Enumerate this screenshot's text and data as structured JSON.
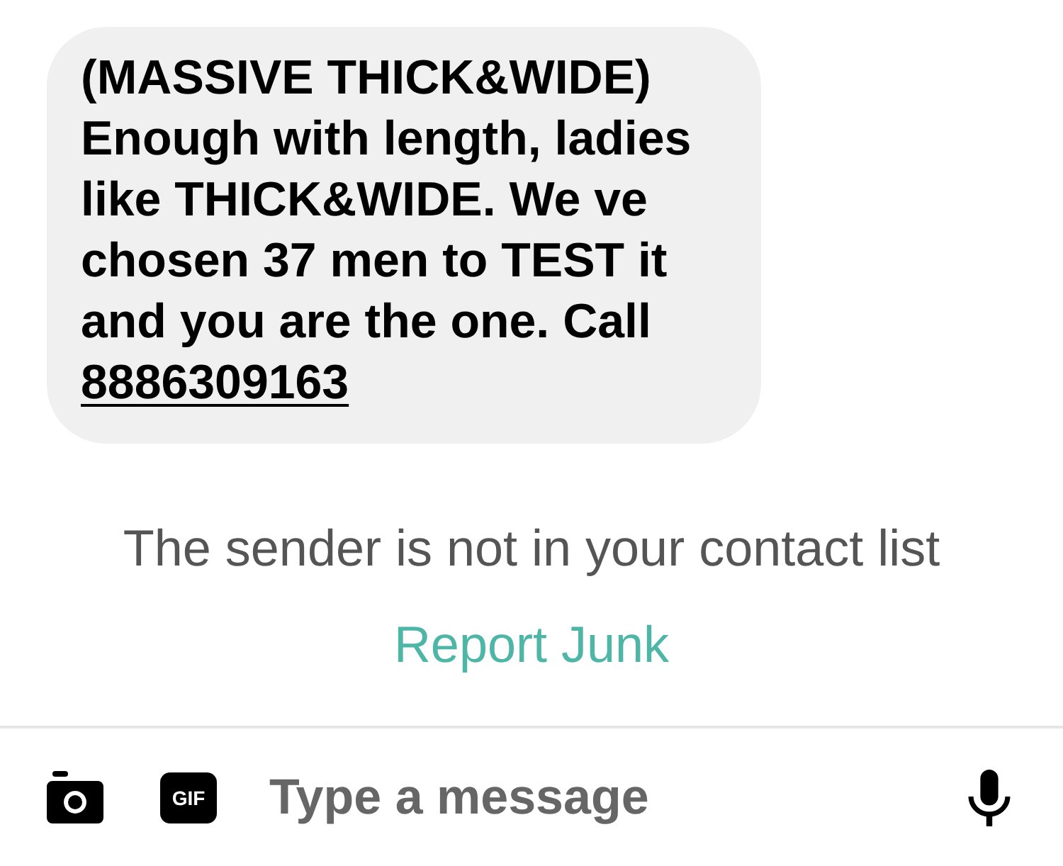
{
  "message": {
    "text": "(MASSIVE THICK&WIDE) Enough with length, ladies like THICK&WIDE. We ve chosen 37 men to TEST it and you are the one. Call",
    "link": "8886309163"
  },
  "notice": {
    "text": "The sender is not in your contact list",
    "action": "Report Junk"
  },
  "composer": {
    "gif_label": "GIF",
    "placeholder": "Type a message"
  }
}
